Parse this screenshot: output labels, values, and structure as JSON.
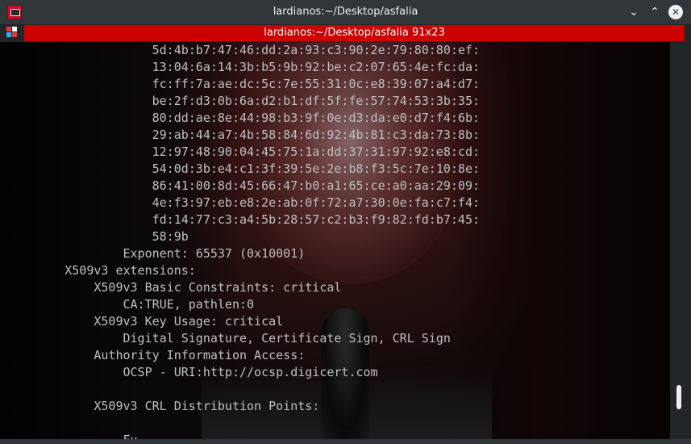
{
  "window": {
    "title": "lardianos:~/Desktop/asfalia",
    "buttons": {
      "chevron": "⌄",
      "minimize": "⌃",
      "close": "✕"
    }
  },
  "tab": {
    "label": "lardianos:~/Desktop/asfalia 91x23"
  },
  "terminal": {
    "lines": [
      "                    5d:4b:b7:47:46:dd:2a:93:c3:90:2e:79:80:80:ef:",
      "                    13:04:6a:14:3b:b5:9b:92:be:c2:07:65:4e:fc:da:",
      "                    fc:ff:7a:ae:dc:5c:7e:55:31:0c:e8:39:07:a4:d7:",
      "                    be:2f:d3:0b:6a:d2:b1:df:5f:fe:57:74:53:3b:35:",
      "                    80:dd:ae:8e:44:98:b3:9f:0e:d3:da:e0:d7:f4:6b:",
      "                    29:ab:44:a7:4b:58:84:6d:92:4b:81:c3:da:73:8b:",
      "                    12:97:48:90:04:45:75:1a:dd:37:31:97:92:e8:cd:",
      "                    54:0d:3b:e4:c1:3f:39:5e:2e:b8:f3:5c:7e:10:8e:",
      "                    86:41:00:8d:45:66:47:b0:a1:65:ce:a0:aa:29:09:",
      "                    4e:f3:97:eb:e8:2e:ab:0f:72:a7:30:0e:fa:c7:f4:",
      "                    fd:14:77:c3:a4:5b:28:57:c2:b3:f9:82:fd:b7:45:",
      "                    58:9b",
      "                Exponent: 65537 (0x10001)",
      "        X509v3 extensions:",
      "            X509v3 Basic Constraints: critical",
      "                CA:TRUE, pathlen:0",
      "            X509v3 Key Usage: critical",
      "                Digital Signature, Certificate Sign, CRL Sign",
      "            Authority Information Access:",
      "                OCSP - URI:http://ocsp.digicert.com",
      "",
      "            X509v3 CRL Distribution Points:",
      "",
      "                Fu"
    ]
  },
  "colors": {
    "tab_active": "#cc0000",
    "titlebar": "#31363b",
    "terminal_text": "#c0c0c0"
  }
}
